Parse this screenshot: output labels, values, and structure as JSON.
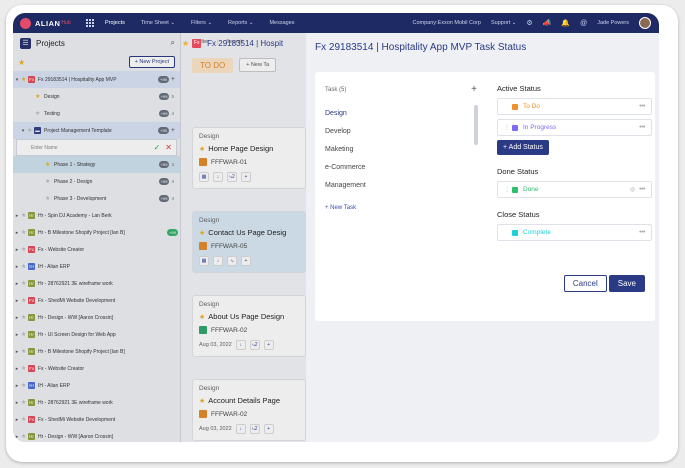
{
  "topnav": {
    "logo": "ALIAN",
    "logo_suffix": "Hub",
    "items": [
      "Projects",
      "Time Sheet ⌄",
      "Filters ⌄",
      "Reports ⌄",
      "Messages"
    ],
    "company": "Company:Exxon Mobil Corp",
    "support": "Support ⌄",
    "user": "Jade Powers"
  },
  "sidebar": {
    "title": "Projects",
    "new_project": "+ New Project",
    "rows": [
      {
        "label": "Fx 29183514 | Hospitality App MVP",
        "tag": "Fx",
        "kind": "fx",
        "caret": "▾",
        "starred": true,
        "pill": "+99",
        "plus": "+",
        "sel": true
      },
      {
        "label": "Design",
        "kind": "sub",
        "pill": "+99",
        "n": "5",
        "starred": true
      },
      {
        "label": "Testing",
        "kind": "sub",
        "pill": "+99",
        "n": "4"
      },
      {
        "label": "Project Management Template",
        "kind": "folder",
        "caret": "▾",
        "pill": "+99",
        "plus": "+",
        "sel": true
      },
      {
        "label": "Enter Name",
        "kind": "edit"
      },
      {
        "label": "Phase 1 - Strategy",
        "kind": "phase",
        "pill": "+99",
        "n": "3",
        "starred": true,
        "active": true
      },
      {
        "label": "Phase 2 - Design",
        "kind": "phase",
        "pill": "+99",
        "n": "4"
      },
      {
        "label": "Phase 3 - Development",
        "kind": "phase",
        "pill": "+99",
        "n": "4"
      },
      {
        "label": "Hr - Spin DJ Academy - Lan Berk",
        "tag": "Hr",
        "kind": "hr"
      },
      {
        "label": "Hr - B Milestone Shopify Project [Ian B]",
        "tag": "Hr",
        "kind": "hr",
        "green_pill": "+99"
      },
      {
        "label": "Fx - Website Creator",
        "tag": "Fx",
        "kind": "fx"
      },
      {
        "label": "IH - Alian ERP",
        "tag": "IH",
        "kind": "ih"
      },
      {
        "label": "Hr - 28762921 3E wireframe work",
        "tag": "Hr",
        "kind": "hr"
      },
      {
        "label": "Fx - ShedMi Website Development",
        "tag": "Fx",
        "kind": "fx"
      },
      {
        "label": "Hr - Design - WW [Aaron Crossin]",
        "tag": "Hr",
        "kind": "hr"
      },
      {
        "label": "Hr - UI Screen Design for Web App",
        "tag": "Hr",
        "kind": "hr"
      },
      {
        "label": "Hr - B Milestone Shopify Project [Ian B]",
        "tag": "Hr",
        "kind": "hr"
      },
      {
        "label": "Fx - Website Creator",
        "tag": "Fx",
        "kind": "fx"
      },
      {
        "label": "IH - Alian ERP",
        "tag": "IH",
        "kind": "ih"
      },
      {
        "label": "Hr - 28762921 3E wireframe work",
        "tag": "Hr",
        "kind": "hr"
      },
      {
        "label": "Fx - ShedMi Website Development",
        "tag": "Fx",
        "kind": "fx"
      },
      {
        "label": "Hr - Design - WW [Aaron Crossin]",
        "tag": "Hr",
        "kind": "hr"
      }
    ]
  },
  "board": {
    "header_title": "Fx 29183514 | Hospit",
    "header_tag": "Fx",
    "filter": "Filter",
    "search_placeholder": "Search",
    "column": "TO DO",
    "new_task": "+ New Ta",
    "cards": [
      {
        "cat": "Design",
        "title": "Home Page Design",
        "code": "FFFWAR-01",
        "code_color": "orange",
        "foot": "",
        "sub": "2"
      },
      {
        "cat": "Design",
        "title": "Contact Us Page Desig",
        "code": "FFFWAR-05",
        "code_color": "orange",
        "foot": "",
        "sub": "",
        "hl": true
      },
      {
        "cat": "Design",
        "title": "About Us Page Design",
        "code": "FFFWAR-02",
        "code_color": "green",
        "foot": "Aug 03, 2022",
        "sub": "2"
      },
      {
        "cat": "Design",
        "title": "Account Details Page",
        "code": "FFFWAR-02",
        "code_color": "orange",
        "foot": "Aug 03, 2022",
        "sub": "2"
      }
    ]
  },
  "modal": {
    "title": "Fx 29183514 | Hospitality App MVP Task Status",
    "task_head": "Task (5)",
    "task_plus": "+",
    "tasks": [
      "Design",
      "Develop",
      "Maketing",
      "e-Commerce",
      "Management"
    ],
    "new_task": "+ New Task",
    "active_title": "Active Status",
    "active": [
      {
        "label": "To Do",
        "color": "#f0922b"
      },
      {
        "label": "In Progress",
        "color": "#7b6cf0"
      }
    ],
    "add_status": "+ Add Status",
    "done_title": "Done Status",
    "done": {
      "label": "Done",
      "color": "#2bc06a"
    },
    "close_title": "Close Status",
    "close": {
      "label": "Complete",
      "color": "#1fd0d8"
    },
    "cancel": "Cancel",
    "save": "Save"
  }
}
